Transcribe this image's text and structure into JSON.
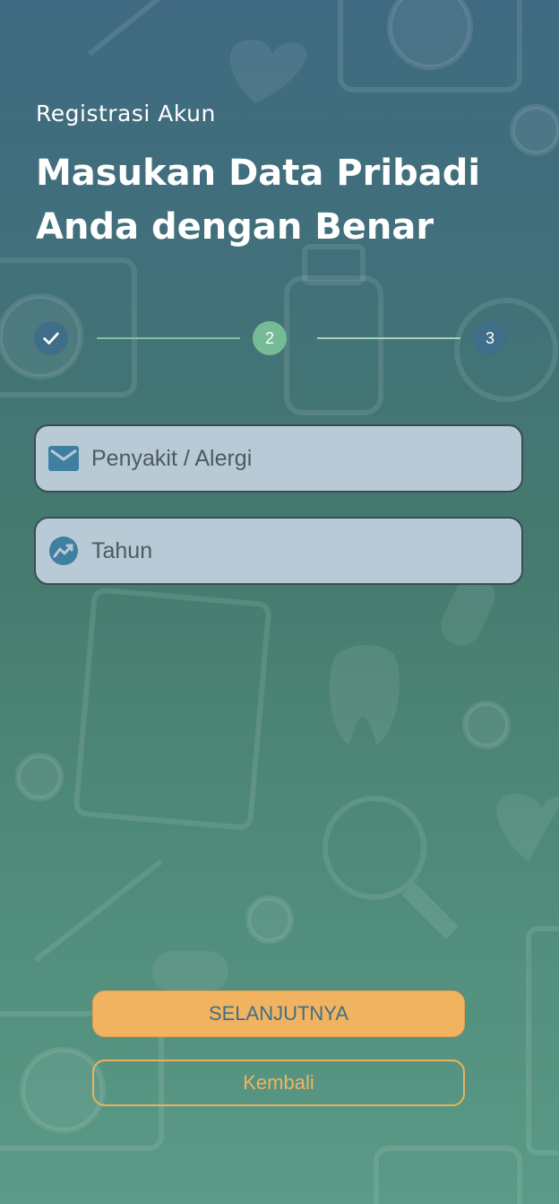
{
  "header": {
    "subtitle": "Registrasi Akun",
    "title_line1": "Masukan Data Pribadi",
    "title_line2": "Anda dengan Benar"
  },
  "stepper": {
    "steps": [
      {
        "label": "",
        "status": "completed",
        "icon": "check-icon"
      },
      {
        "label": "2",
        "status": "active"
      },
      {
        "label": "3",
        "status": "pending"
      }
    ]
  },
  "form": {
    "disease_field": {
      "placeholder": "Penyakit / Alergi",
      "value": "",
      "icon": "mail-icon"
    },
    "year_field": {
      "placeholder": "Tahun",
      "value": "",
      "icon": "trend-chart-icon"
    }
  },
  "actions": {
    "next_label": "SELANJUTNYA",
    "back_label": "Kembali"
  },
  "colors": {
    "accent": "#f2b360",
    "step_active": "#76bb96",
    "step_inactive": "#3f6f88",
    "field_bg": "#b8cad6"
  }
}
